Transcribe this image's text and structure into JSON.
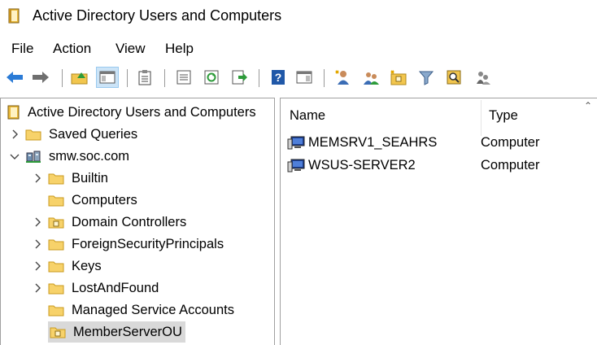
{
  "window": {
    "title": "Active Directory Users and Computers"
  },
  "menu": [
    "File",
    "Action",
    "View",
    "Help"
  ],
  "toolbar": {
    "buttons": [
      "back-icon",
      "forward-icon",
      "up-folder-icon",
      "show-hide-console-tree-icon",
      "properties-icon",
      "export-list-icon",
      "refresh-icon",
      "export-icon",
      "help-icon",
      "action-pane-icon",
      "new-user-icon",
      "new-group-icon",
      "new-ou-icon",
      "filter-icon",
      "find-icon",
      "add-to-group-icon"
    ]
  },
  "tree": {
    "root": "Active Directory Users and Computers",
    "items": [
      {
        "label": "Saved Queries",
        "level": 1,
        "expander": "collapsed"
      },
      {
        "label": "smw.soc.com",
        "level": 1,
        "expander": "expanded"
      },
      {
        "label": "Builtin",
        "level": 2,
        "expander": "collapsed"
      },
      {
        "label": "Computers",
        "level": 2,
        "expander": "none"
      },
      {
        "label": "Domain Controllers",
        "level": 2,
        "expander": "collapsed"
      },
      {
        "label": "ForeignSecurityPrincipals",
        "level": 2,
        "expander": "collapsed"
      },
      {
        "label": "Keys",
        "level": 2,
        "expander": "collapsed"
      },
      {
        "label": "LostAndFound",
        "level": 2,
        "expander": "collapsed"
      },
      {
        "label": "Managed Service Accounts",
        "level": 2,
        "expander": "none"
      },
      {
        "label": "MemberServerOU",
        "level": 2,
        "expander": "none",
        "selected": true
      }
    ]
  },
  "list": {
    "columns": [
      "Name",
      "Type"
    ],
    "rows": [
      {
        "name": "MEMSRV1_SEAHRS",
        "type": "Computer"
      },
      {
        "name": "WSUS-SERVER2",
        "type": "Computer"
      }
    ]
  },
  "colors": {
    "selection": "#d9d9d9",
    "toolbar_active": "#cce4f7",
    "folder": "#f7d26a"
  }
}
